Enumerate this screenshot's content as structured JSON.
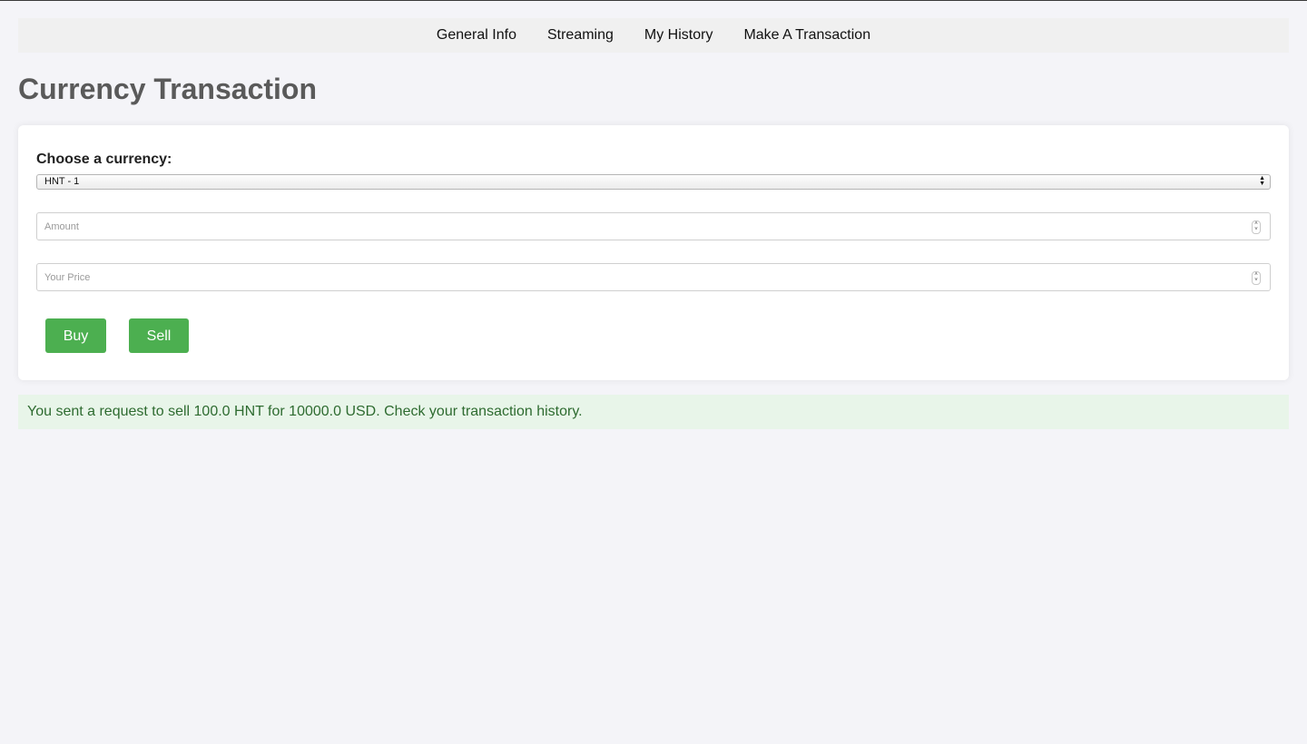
{
  "nav": {
    "items": [
      {
        "label": "General Info"
      },
      {
        "label": "Streaming"
      },
      {
        "label": "My History"
      },
      {
        "label": "Make A Transaction"
      }
    ]
  },
  "page": {
    "title": "Currency Transaction"
  },
  "form": {
    "currency_label": "Choose a currency:",
    "currency_selected": "HNT - 1",
    "amount_placeholder": "Amount",
    "price_placeholder": "Your Price",
    "buy_label": "Buy",
    "sell_label": "Sell"
  },
  "message": {
    "text": "You sent a request to sell 100.0 HNT for 10000.0 USD. Check your transaction history."
  },
  "colors": {
    "button": "#4caf50",
    "success_bg": "#e8f5e9",
    "success_text": "#2e6b30"
  },
  "icons": {
    "select_arrows": "up-down-arrows-icon",
    "stepper": "number-stepper-icon"
  }
}
